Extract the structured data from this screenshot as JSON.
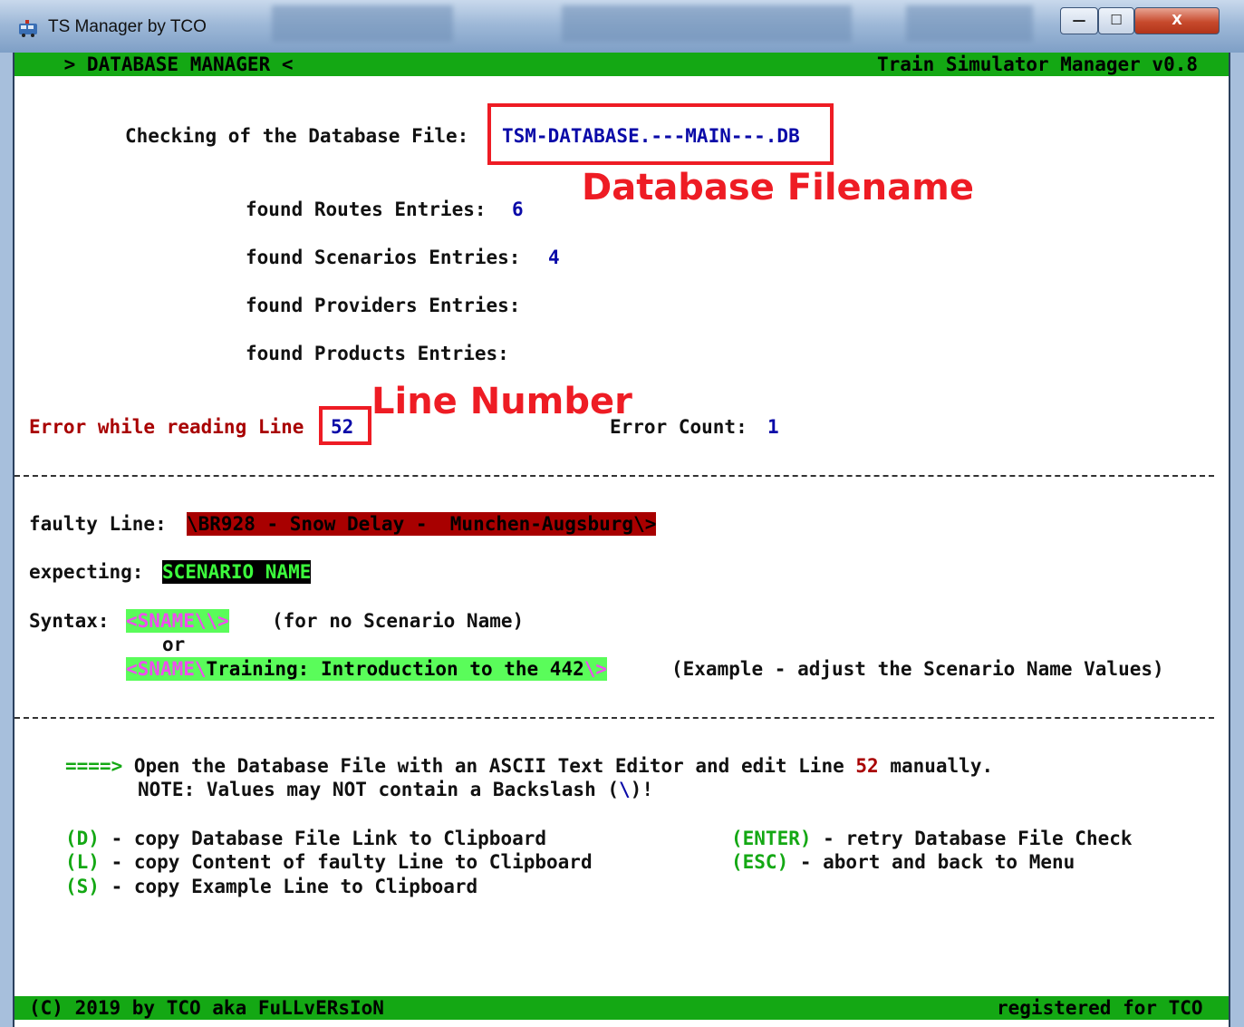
{
  "window": {
    "title": "TS Manager by TCO",
    "buttons": {
      "minimize": "—",
      "maximize": "☐",
      "close": "X"
    }
  },
  "header": {
    "left": " > DATABASE MANAGER <",
    "right": "Train Simulator Manager v0.8"
  },
  "check": {
    "label": "Checking of the Database File:",
    "filename": "TSM-DATABASE.---MAIN---.DB"
  },
  "counts": [
    {
      "label": "found Routes Entries:",
      "value": "6"
    },
    {
      "label": "found Scenarios Entries:",
      "value": "4"
    },
    {
      "label": "found Providers Entries:",
      "value": ""
    },
    {
      "label": "found Products Entries:",
      "value": ""
    }
  ],
  "error": {
    "label": "Error while reading Line",
    "line": "52",
    "count_label": "Error Count:",
    "count": "1"
  },
  "faulty": {
    "label": "faulty Line:",
    "value": "\\BR928 - Snow Delay -  Munchen-Augsburg\\>"
  },
  "expecting": {
    "label": "expecting:",
    "value": "SCENARIO NAME"
  },
  "syntax": {
    "label": "Syntax:",
    "form1": "<SNAME\\\\>",
    "form1_note": "(for no Scenario Name)",
    "or": "or",
    "form2_tag": "<SNAME\\",
    "form2_value": "Training: Introduction to the 442",
    "form2_end": "\\>",
    "form2_note": "(Example - adjust the Scenario Name Values)"
  },
  "instructions": {
    "arrow": "====>",
    "line1_a": " Open the Database File with an ASCII Text Editor and edit Line ",
    "line1_num": "52",
    "line1_b": " manually.",
    "line2_a": "NOTE: Values may NOT contain a Backslash (",
    "line2_bs": "\\",
    "line2_b": ")!"
  },
  "actions": [
    {
      "key": "(D)",
      "text": " - copy Database File Link to Clipboard"
    },
    {
      "key": "(L)",
      "text": " - copy Content of faulty Line to Clipboard"
    },
    {
      "key": "(S)",
      "text": " - copy Example Line to Clipboard"
    },
    {
      "key": "(ENTER)",
      "text": " - retry Database File Check"
    },
    {
      "key": "(ESC)",
      "text": " - abort and back to Menu"
    }
  ],
  "footer": {
    "left": "(C) 2019 by TCO aka FuLLvERsIoN",
    "right": "registered for TCO"
  },
  "annotations": {
    "filename": "Database Filename",
    "line_number": "Line Number"
  },
  "colors": {
    "bar_green": "#14a814",
    "text_blue": "#0a0aa8",
    "text_red": "#a80000",
    "annotation_red": "#ee1c24"
  }
}
